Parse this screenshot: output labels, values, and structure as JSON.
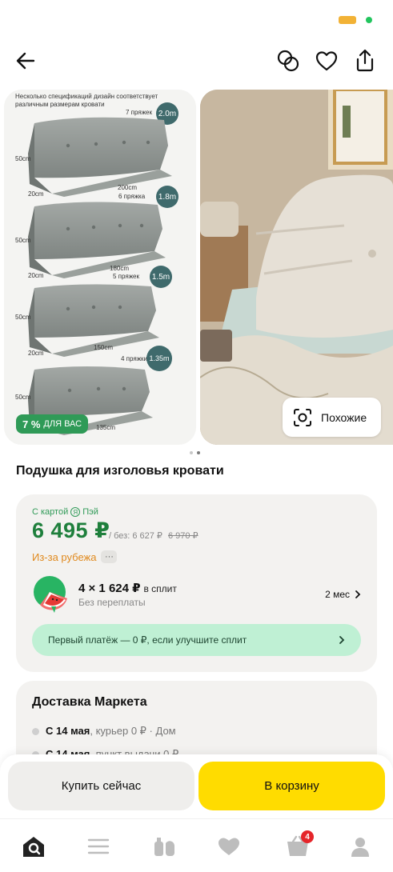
{
  "toolbar": {
    "back_icon": "arrow-left-icon",
    "compare_icon": "compare-icon",
    "favorite_icon": "heart-icon",
    "share_icon": "share-icon"
  },
  "gallery": {
    "slide1": {
      "caption": "Несколько спецификаций дизайн соответствует различным размерам кровати",
      "rows": [
        {
          "buckle": "7 пряжек",
          "size": "2.0m",
          "height": "50cm",
          "depth": "20cm",
          "length": "200cm"
        },
        {
          "buckle": "6 пряжка",
          "size": "1.8m",
          "height": "50cm",
          "depth": "20cm",
          "length": "180cm"
        },
        {
          "buckle": "5 пряжек",
          "size": "1.5m",
          "height": "50cm",
          "depth": "20cm",
          "length": "150cm"
        },
        {
          "buckle": "4 пряжки",
          "size": "1.35m",
          "height": "50cm",
          "depth": "20cm",
          "length": "135cm"
        }
      ],
      "promo_percent": "7 %",
      "promo_text": "ДЛЯ ВАС"
    },
    "similar_label": "Похожие",
    "page_count": 2,
    "active_page": 2
  },
  "product": {
    "title": "Подушка для изголовья кровати"
  },
  "price": {
    "card_label_prefix": "С картой",
    "card_logo": "Я",
    "card_label_suffix": "Пэй",
    "main": "6 495 ₽",
    "without_label": "/ без: 6 627 ₽",
    "old_price": "6 970 ₽",
    "abroad_label": "Из-за рубежа",
    "abroad_more": "···",
    "colors": {
      "price": "#1e7f3c",
      "abroad": "#e08a1e",
      "split_banner": "#bff0d4"
    }
  },
  "split": {
    "amount": "4 × 1 624 ₽",
    "suffix": "в сплит",
    "subtitle": "Без переплаты",
    "months": "2 мес",
    "first_payment": "Первый платёж — 0 ₽, если улучшите сплит"
  },
  "delivery": {
    "title": "Доставка Маркета",
    "rows": [
      {
        "date": "С 14 мая",
        "rest": ", курьер 0 ₽ · Дом"
      },
      {
        "date": "С 14 мая",
        "rest": ", пункт выдачи 0 ₽"
      }
    ]
  },
  "actions": {
    "buy_now": "Купить сейчас",
    "add_to_cart": "В корзину",
    "cart_color": "#ffdc00"
  },
  "nav": {
    "items": [
      {
        "icon": "home-search-icon"
      },
      {
        "icon": "catalog-menu-icon"
      },
      {
        "icon": "grocery-icon"
      },
      {
        "icon": "heart-icon"
      },
      {
        "icon": "cart-icon",
        "badge": "4"
      },
      {
        "icon": "profile-icon"
      }
    ]
  }
}
